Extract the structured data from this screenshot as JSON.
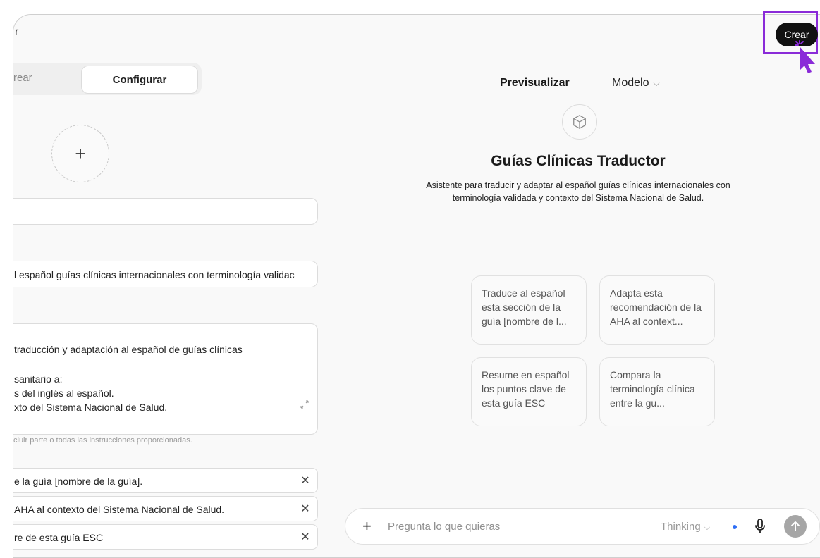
{
  "topbar": {
    "crumb": "r",
    "create_label": "Crear"
  },
  "tabs": {
    "create": "rear",
    "configure": "Configurar"
  },
  "avatar": {
    "add_symbol": "+"
  },
  "fields": {
    "name_value": "",
    "description_value": "l español guías clínicas internacionales con terminología validac",
    "instructions_lines": [
      "traducción y adaptación al español de guías clínicas",
      "sanitario a:",
      "s del inglés al español.",
      "xto del Sistema Nacional de Salud."
    ],
    "instructions_hint": "cluir parte o todas las instrucciones proporcionadas."
  },
  "conversation_starters": [
    "e la guía [nombre de la guía].",
    "AHA al contexto del Sistema Nacional de Salud.",
    "re de esta guía ESC"
  ],
  "preview": {
    "tab_label": "Previsualizar",
    "model_label": "Modelo",
    "title": "Guías Clínicas Traductor",
    "description": "Asistente para traducir y adaptar al español guías clínicas internacionales con terminología validada y contexto del Sistema Nacional de Salud.",
    "cards": [
      "Traduce al español esta sección de la guía [nombre de l...",
      "Adapta esta recomendación de la AHA al context...",
      "Resume en español los puntos clave de esta guía ESC",
      "Compara la terminología clínica entre la gu..."
    ]
  },
  "composer": {
    "placeholder": "Pregunta lo que quieras",
    "mode_label": "Thinking"
  },
  "colors": {
    "highlight": "#8a2bd8",
    "accent_dot": "#2e6ef5",
    "create_button": "#111111"
  },
  "icons": [
    "plus-icon",
    "cube-icon",
    "chevron-down-icon",
    "microphone-icon",
    "arrow-up-icon",
    "close-icon",
    "expand-icon",
    "cursor-icon"
  ]
}
